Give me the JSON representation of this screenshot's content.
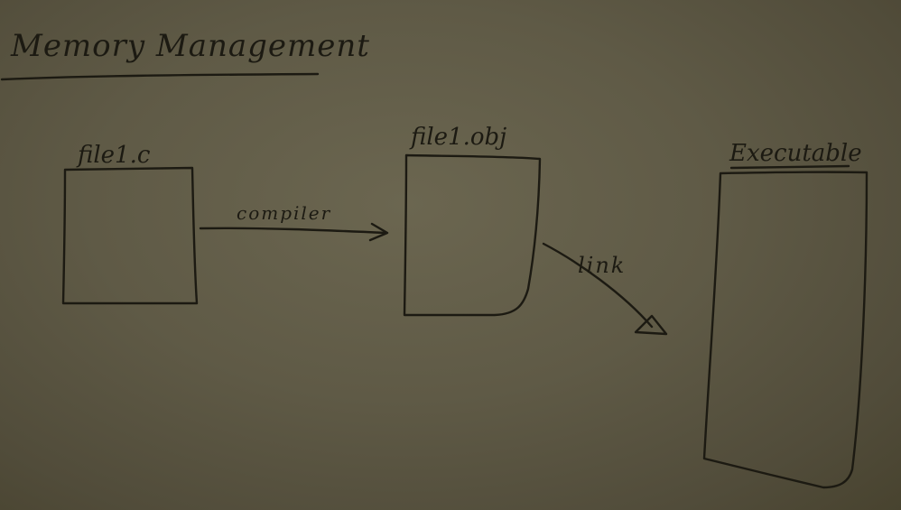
{
  "title": "Memory Management",
  "nodes": {
    "source": {
      "label": "file1.c"
    },
    "object": {
      "label": "file1.obj"
    },
    "executable": {
      "label": "Executable"
    }
  },
  "edges": {
    "compile": {
      "label": "compiler"
    },
    "link": {
      "label": "link"
    }
  },
  "colors": {
    "board": "#5f5a46",
    "ink": "#1c1a12"
  }
}
